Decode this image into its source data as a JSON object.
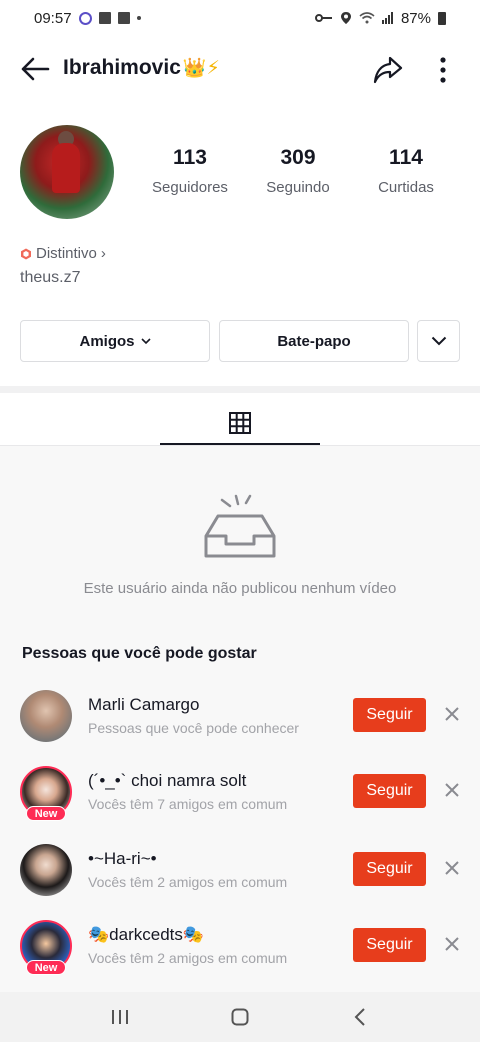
{
  "status_bar": {
    "time": "09:57",
    "battery": "87%"
  },
  "header": {
    "title": "Ibrahimovic",
    "title_emojis": "👑⚡"
  },
  "profile": {
    "stats": [
      {
        "value": "113",
        "label": "Seguidores"
      },
      {
        "value": "309",
        "label": "Seguindo"
      },
      {
        "value": "114",
        "label": "Curtidas"
      }
    ],
    "badge_label": "Distintivo",
    "badge_chevron": "›",
    "username": "theus.z7"
  },
  "actions": {
    "friends_label": "Amigos",
    "chat_label": "Bate-papo"
  },
  "empty_state": {
    "message": "Este usuário ainda não publicou nenhum vídeo"
  },
  "suggestions": {
    "title": "Pessoas que você pode gostar",
    "follow_label": "Seguir",
    "new_label": "New",
    "items": [
      {
        "name": "Marli Camargo",
        "subtitle": "Pessoas que você pode conhecer",
        "is_new": false
      },
      {
        "name": "(´•_•` choi namra solt",
        "subtitle": "Vocês têm 7 amigos em comum",
        "is_new": true
      },
      {
        "name": "•~Ha-ri~•",
        "subtitle": "Vocês têm 2 amigos em comum",
        "is_new": false
      },
      {
        "name": "🎭darkcedts🎭",
        "subtitle": "Vocês têm 2 amigos em comum",
        "is_new": true
      }
    ]
  },
  "colors": {
    "accent": "#e73d1c",
    "new_badge": "#fe2c55",
    "text_primary": "#161823",
    "text_secondary": "#5c5f68"
  }
}
